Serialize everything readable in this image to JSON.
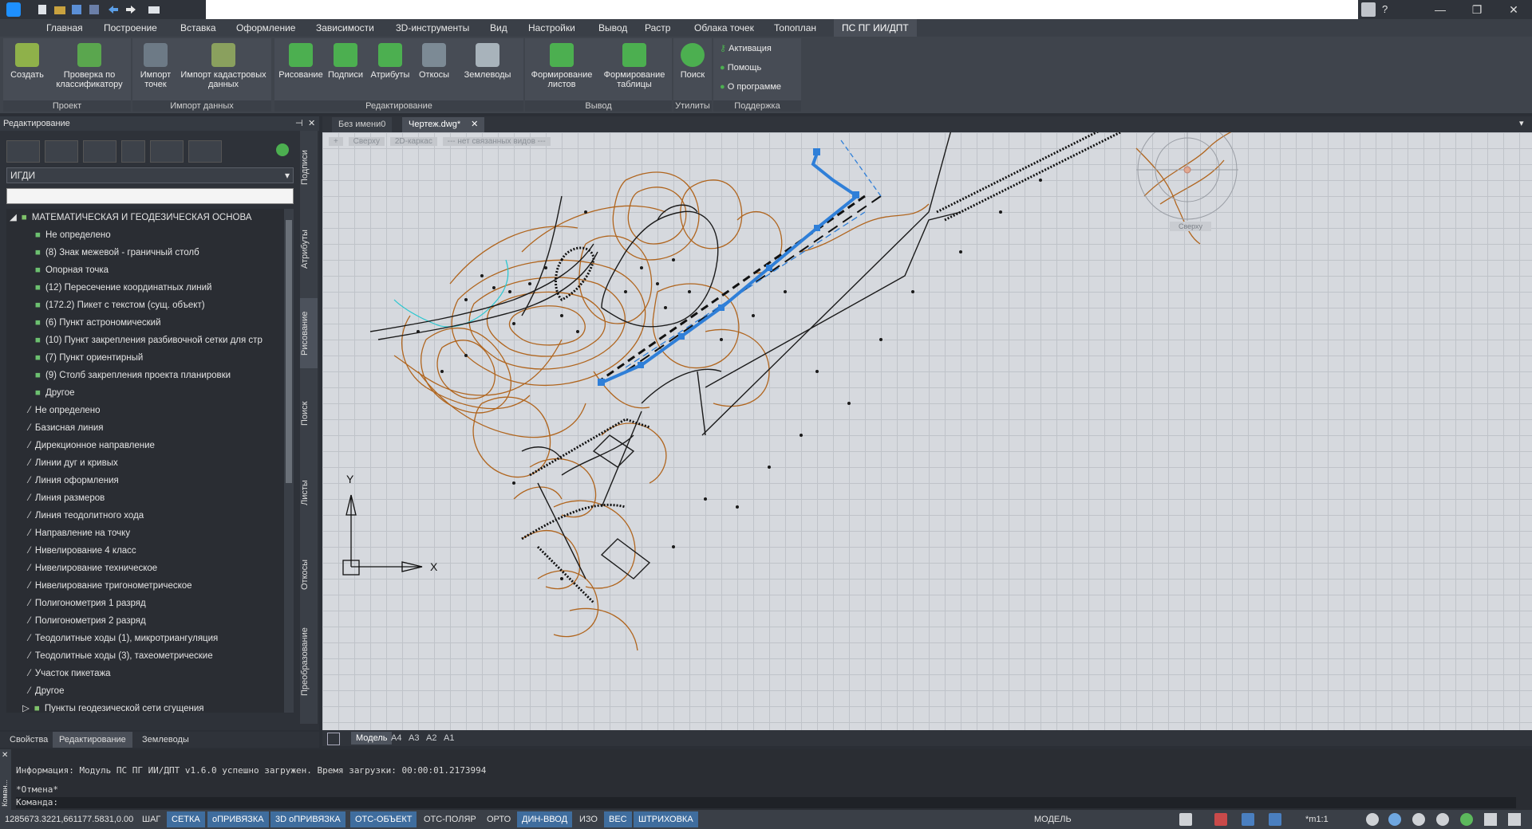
{
  "titlebar": {
    "close": "✕",
    "maximize": "❐",
    "minimize": "—",
    "help": "?"
  },
  "ribbon_tabs": [
    "Главная",
    "Построение",
    "Вставка",
    "Оформление",
    "Зависимости",
    "3D-инструменты",
    "Вид",
    "Настройки",
    "Вывод",
    "Растр",
    "Облака точек",
    "Топоплан",
    "ПС ПГ ИИ/ДПТ"
  ],
  "ribbon": {
    "project": {
      "label": "Проект",
      "create": "Создать",
      "check": "Проверка по классификатору"
    },
    "import": {
      "label": "Импорт данных",
      "points": "Импорт точек",
      "cadastre": "Импорт кадастровых данных"
    },
    "edit": {
      "label": "Редактирование",
      "draw": "Рисование",
      "labels": "Подписи",
      "attrs": "Атрибуты",
      "slopes": "Откосы",
      "earthworks": "Землеводы"
    },
    "output": {
      "label": "Вывод",
      "sheets": "Формирование листов",
      "table": "Формирование таблицы"
    },
    "utils": {
      "label": "Утилиты",
      "search": "Поиск"
    },
    "support": {
      "label": "Поддержка",
      "activation": "Активация",
      "help": "Помощь",
      "about": "О программе"
    }
  },
  "left_panel": {
    "title": "Редактирование",
    "classifier": "ИГДИ",
    "search_value": "",
    "tree_root": "МАТЕМАТИЧЕСКАЯ И ГЕОДЕЗИЧЕСКАЯ ОСНОВА",
    "point_items": [
      "Не определено",
      "(8) Знак межевой - граничный столб",
      "Опорная точка",
      "(12) Пересечение координатных линий",
      "(172.2) Пикет с текстом (сущ. объект)",
      "(6) Пункт астрономический",
      "(10) Пункт закрепления разбивочной сетки для стр",
      "(7) Пункт ориентирный",
      "(9) Столб закрепления проекта планировки",
      "Другое"
    ],
    "line_items": [
      "Не определено",
      "Базисная линия",
      "Дирекционное направление",
      "Линии дуг и кривых",
      "Линия оформления",
      "Линия размеров",
      "Линия теодолитного хода",
      "Направление на точку",
      "Нивелирование 4 класс",
      "Нивелирование техническое",
      "Нивелирование тригонометрическое",
      "Полигонометрия 1 разряд",
      "Полигонометрия 2 разряд",
      "Теодолитные ходы (1), микротриангуляция",
      "Теодолитные ходы (3), тахеометрические",
      "Участок пикетажа",
      "Другое"
    ],
    "tree_next": "Пункты геодезической сети сгущения",
    "side_tabs": [
      "Подписи",
      "Атрибуты",
      "Рисование",
      "Поиск",
      "Листы",
      "Откосы",
      "Преобразование"
    ],
    "bottom_tabs": [
      "Свойства",
      "Редактирование",
      "Землеводы"
    ]
  },
  "doc_tabs": [
    "Без имени0",
    "Чертеж.dwg*"
  ],
  "view_controls": {
    "plus": "+",
    "view": "Сверху",
    "style": "2D-каркас",
    "named": "--- нет связанных видов ---"
  },
  "viewcube_label": "Сверху",
  "axis": {
    "y": "Y",
    "x": "X"
  },
  "layout_tabs": [
    "Модель",
    "A4",
    "A3",
    "A2",
    "A1"
  ],
  "command": {
    "info": "Информация: Модуль ПС ПГ ИИ/ДПТ v1.6.0 успешно загружен. Время загрузки: 00:00:01.2173994",
    "cancel": "*Отмена*",
    "prompt": "Команда:",
    "side_label": "Коман..."
  },
  "status": {
    "coords": "1285673.3221,661177.5831,0.00",
    "toggles": [
      {
        "label": "ШАГ",
        "on": false
      },
      {
        "label": "СЕТКА",
        "on": true
      },
      {
        "label": "оПРИВЯЗКА",
        "on": true
      },
      {
        "label": "3D оПРИВЯЗКА",
        "on": true
      },
      {
        "label": "ОТС-ОБЪЕКТ",
        "on": true
      },
      {
        "label": "ОТС-ПОЛЯР",
        "on": false
      },
      {
        "label": "ОРТО",
        "on": false
      },
      {
        "label": "ДИН-ВВОД",
        "on": true
      },
      {
        "label": "ИЗО",
        "on": false
      },
      {
        "label": "ВЕС",
        "on": true
      },
      {
        "label": "ШТРИХОВКА",
        "on": true
      }
    ],
    "model": "МОДЕЛЬ",
    "scale": "*m1:1"
  },
  "colors": {
    "accent": "#3f6d9e",
    "contour": "#b0651e",
    "selection": "#2f7fd8",
    "cyan": "#29c7d0"
  }
}
